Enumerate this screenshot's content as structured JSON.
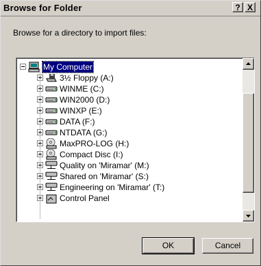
{
  "window": {
    "title": "Browse for Folder",
    "help_label": "?",
    "close_label": "X"
  },
  "instruction": "Browse for a directory to import files:",
  "tree": {
    "items": [
      {
        "label": "My Computer",
        "icon": "computer-icon",
        "expander": "minus",
        "selected": true,
        "level": 0
      },
      {
        "label": "3½ Floppy (A:)",
        "icon": "floppy-drive-icon",
        "expander": "plus",
        "level": 1
      },
      {
        "label": "WINME (C:)",
        "icon": "hard-drive-icon",
        "expander": "plus",
        "level": 1
      },
      {
        "label": "WIN2000 (D:)",
        "icon": "hard-drive-icon",
        "expander": "plus",
        "level": 1
      },
      {
        "label": "WINXP (E:)",
        "icon": "hard-drive-icon",
        "expander": "plus",
        "level": 1
      },
      {
        "label": "DATA (F:)",
        "icon": "hard-drive-icon",
        "expander": "plus",
        "level": 1
      },
      {
        "label": "NTDATA (G:)",
        "icon": "hard-drive-icon",
        "expander": "plus",
        "level": 1
      },
      {
        "label": "MaxPRO-LOG (H:)",
        "icon": "cd-drive-icon",
        "expander": "plus",
        "level": 1
      },
      {
        "label": "Compact Disc (I:)",
        "icon": "cd-drive-icon",
        "expander": "plus",
        "level": 1
      },
      {
        "label": "Quality on 'Miramar' (M:)",
        "icon": "network-drive-icon",
        "expander": "plus",
        "level": 1
      },
      {
        "label": "Shared on 'Miramar' (S:)",
        "icon": "network-drive-icon",
        "expander": "plus",
        "level": 1
      },
      {
        "label": "Engineering on 'Miramar' (T:)",
        "icon": "network-drive-icon",
        "expander": "plus",
        "level": 1
      },
      {
        "label": "Control Panel",
        "icon": "control-panel-icon",
        "expander": "plus",
        "level": 1
      }
    ]
  },
  "buttons": {
    "ok": "OK",
    "cancel": "Cancel"
  },
  "colors": {
    "dialog_bg": "#d4d0c8",
    "selection": "#000080"
  }
}
